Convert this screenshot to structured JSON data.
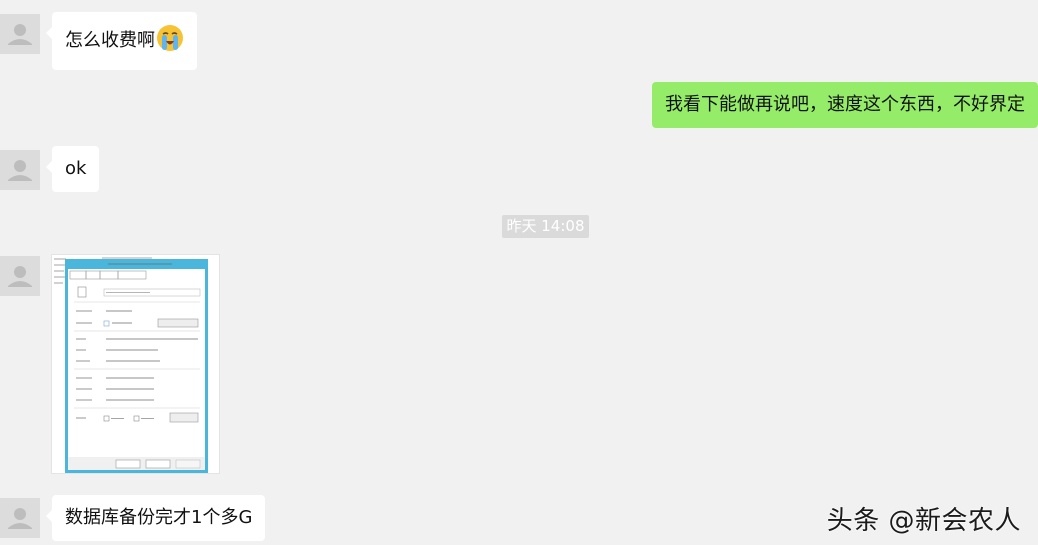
{
  "messages": [
    {
      "sender": "other",
      "text": "怎么收费啊",
      "emoji": "loudly-crying-face"
    },
    {
      "sender": "self",
      "text": "我看下能做再说吧，速度这个东西，不好界定"
    },
    {
      "sender": "other",
      "text": "ok"
    },
    {
      "sender": "other",
      "type": "image",
      "description_icon": "file-properties-dialog-screenshot"
    },
    {
      "sender": "other",
      "text": "数据库备份完才1个多G"
    }
  ],
  "timestamp": "昨天 14:08",
  "watermark": "头条 @新会农人",
  "colors": {
    "background": "#f1f1f1",
    "incoming_bubble": "#ffffff",
    "outgoing_bubble": "#95ec69",
    "timestamp_bg": "#dadada"
  }
}
